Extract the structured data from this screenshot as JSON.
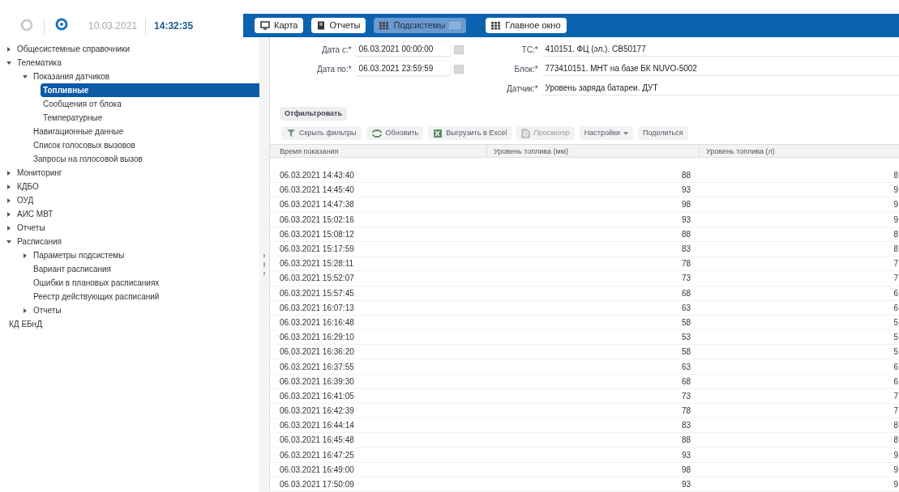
{
  "header": {
    "date": "10.03.2021",
    "time": "14:32:35",
    "nav": [
      {
        "label": "Карта",
        "selected": false
      },
      {
        "label": "Отчеты",
        "selected": false
      },
      {
        "label": "Подсистемы",
        "selected": true
      },
      {
        "label": "Главное окно",
        "selected": false
      }
    ]
  },
  "sidebar": {
    "items": [
      {
        "label": "Общесистемные справочники",
        "expanded": false,
        "selected": false
      },
      {
        "label": "Телематика",
        "expanded": true,
        "selected": false,
        "children": [
          {
            "label": "Показания датчиков",
            "expanded": true,
            "selected": false,
            "children": [
              {
                "label": "Топливные",
                "selected": true
              },
              {
                "label": "Сообщения от блока",
                "selected": false
              },
              {
                "label": "Температурные",
                "selected": false
              }
            ]
          },
          {
            "label": "Навигационные данные",
            "selected": false
          },
          {
            "label": "Список голосовых вызовов",
            "selected": false
          },
          {
            "label": "Запросы на голосовой вызов",
            "selected": false
          }
        ]
      },
      {
        "label": "Мониторинг",
        "expanded": false,
        "selected": false
      },
      {
        "label": "КДБО",
        "expanded": false,
        "selected": false
      },
      {
        "label": "ОУД",
        "expanded": false,
        "selected": false
      },
      {
        "label": "АИС МВТ",
        "expanded": false,
        "selected": false
      },
      {
        "label": "Отчеты",
        "expanded": false,
        "selected": false
      },
      {
        "label": "Расписания",
        "expanded": true,
        "selected": false,
        "children": [
          {
            "label": "Параметры подсистемы",
            "expanded": false,
            "selected": false
          },
          {
            "label": "Вариант расписания",
            "selected": false
          },
          {
            "label": "Ошибки в плановых расписаниях",
            "selected": false
          },
          {
            "label": "Реестр действующих расписаний",
            "selected": false
          },
          {
            "label": "Отчеты",
            "expanded": false,
            "selected": false
          }
        ]
      },
      {
        "label": "КД ЕБнД",
        "selected": false
      }
    ]
  },
  "filters": {
    "date_from": {
      "label": "Дата с:*",
      "value": "06.03.2021 00:00:00"
    },
    "date_to": {
      "label": "Дата по:*",
      "value": "06.03.2021 23:59:59"
    },
    "vehicle": {
      "label": "ТС:*",
      "value": "410151. ФЦ (эл.). СВ50177"
    },
    "unit": {
      "label": "Блок:*",
      "value": "773410151. МНТ на базе БК NUVO-5002"
    },
    "sensor": {
      "label": "Датчик:*",
      "value": "Уровень заряда батареи. ДУТ"
    },
    "apply_button": "Отфильтровать"
  },
  "toolbar": [
    {
      "label": "Скрыть фильтры",
      "disabled": false
    },
    {
      "label": "Обновить",
      "disabled": false
    },
    {
      "label": "Выгрузить в Excel",
      "disabled": false
    },
    {
      "label": "Просмотр",
      "disabled": true
    },
    {
      "label": "Настройки",
      "disabled": false
    },
    {
      "label": "Поделиться",
      "disabled": false
    }
  ],
  "table": {
    "columns": [
      "Время показания",
      "Уровень топлива (мм)",
      "Уровень топлива (л)"
    ],
    "rows": [
      [
        "06.03.2021 14:43:40",
        "88",
        "8"
      ],
      [
        "06.03.2021 14:45:40",
        "93",
        "9"
      ],
      [
        "06.03.2021 14:47:38",
        "98",
        "9"
      ],
      [
        "06.03.2021 15:02:16",
        "93",
        "9"
      ],
      [
        "06.03.2021 15:08:12",
        "88",
        "8"
      ],
      [
        "06.03.2021 15:17:59",
        "83",
        "8"
      ],
      [
        "06.03.2021 15:28:11",
        "78",
        "7"
      ],
      [
        "06.03.2021 15:52:07",
        "73",
        "7"
      ],
      [
        "06.03.2021 15:57:45",
        "68",
        "6"
      ],
      [
        "06.03.2021 16:07:13",
        "63",
        "6"
      ],
      [
        "06.03.2021 16:16:48",
        "58",
        "5"
      ],
      [
        "06.03.2021 16:29:10",
        "53",
        "5"
      ],
      [
        "06.03.2021 16:36:20",
        "58",
        "5"
      ],
      [
        "06.03.2021 16:37:55",
        "63",
        "6"
      ],
      [
        "06.03.2021 16:39:30",
        "68",
        "6"
      ],
      [
        "06.03.2021 16:41:05",
        "73",
        "7"
      ],
      [
        "06.03.2021 16:42:39",
        "78",
        "7"
      ],
      [
        "06.03.2021 16:44:14",
        "83",
        "8"
      ],
      [
        "06.03.2021 16:45:48",
        "88",
        "8"
      ],
      [
        "06.03.2021 16:47:25",
        "93",
        "9"
      ],
      [
        "06.03.2021 16:49:00",
        "98",
        "9"
      ],
      [
        "06.03.2021 17:50:09",
        "93",
        "9"
      ]
    ]
  }
}
